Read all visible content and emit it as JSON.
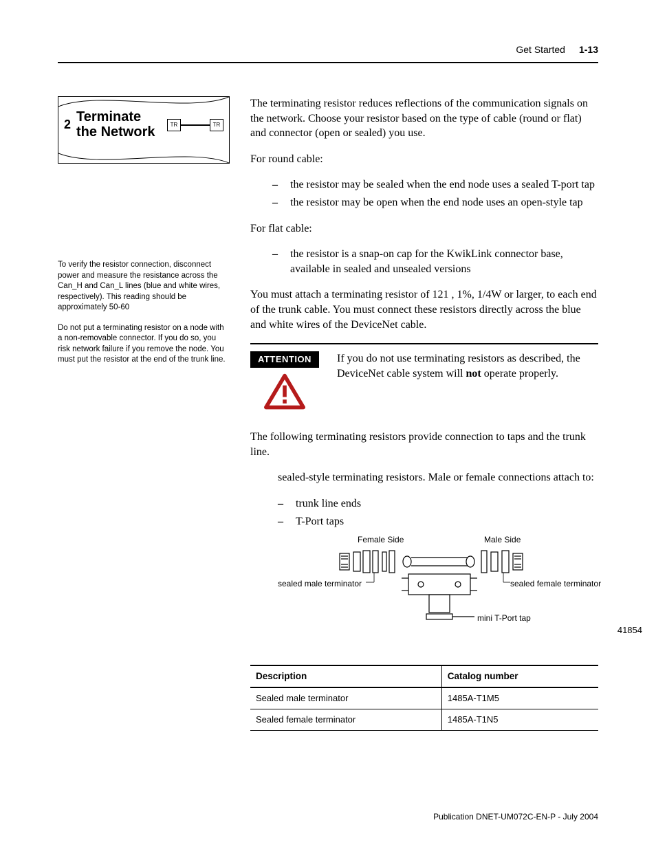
{
  "header": {
    "section": "Get Started",
    "page_number": "1-13"
  },
  "sidebar": {
    "step_number": "2",
    "step_title": "Terminate the Network",
    "tr_label": "TR",
    "note1": "To verify the resistor connection, disconnect power and measure the resistance across the Can_H and Can_L lines (blue and white wires, respectively). This reading should be approximately 50-60",
    "note2": "Do not put a terminating resistor on a node with a non-removable connector. If you do so, you risk network failure if you remove the node. You must put the resistor at the end of the trunk line."
  },
  "main": {
    "intro": "The terminating resistor reduces reflections of the communication signals on the network. Choose your resistor based on the type of cable (round or flat) and connector (open or sealed) you use.",
    "round_head": "For round cable:",
    "round_items": [
      "the resistor may be sealed when the end node uses a sealed T-port tap",
      "the resistor may be open when the end node uses an open-style tap"
    ],
    "flat_head": "For flat cable:",
    "flat_items": [
      "the resistor is a snap-on cap for the KwikLink connector base, available in sealed and unsealed versions"
    ],
    "spec": "You must attach a terminating resistor of 121  , 1%, 1/4W or larger, to each end of the trunk cable. You must connect these resistors directly across the blue and white wires of the DeviceNet cable.",
    "attention_label": "ATTENTION",
    "attention_text_pre": "If you do not use terminating resistors as described, the DeviceNet cable system will ",
    "attention_text_bold": "not",
    "attention_text_post": " operate properly.",
    "following": "The following terminating resistors provide connection to taps and the trunk line.",
    "sealed_bullet": "sealed-style terminating resistors. Male or female connections attach to:",
    "sealed_sub": [
      "trunk line ends",
      "T-Port taps"
    ],
    "figure": {
      "female_side": "Female Side",
      "male_side": "Male Side",
      "sealed_male": "sealed male terminator",
      "sealed_female": "sealed female terminator",
      "mini_tport": "mini T-Port tap",
      "fig_number": "41854"
    },
    "table": {
      "headers": [
        "Description",
        "Catalog number"
      ],
      "rows": [
        [
          "Sealed male terminator",
          "1485A-T1M5"
        ],
        [
          "Sealed female terminator",
          "1485A-T1N5"
        ]
      ]
    }
  },
  "footer": {
    "pubinfo": "Publication DNET-UM072C-EN-P - July 2004"
  }
}
